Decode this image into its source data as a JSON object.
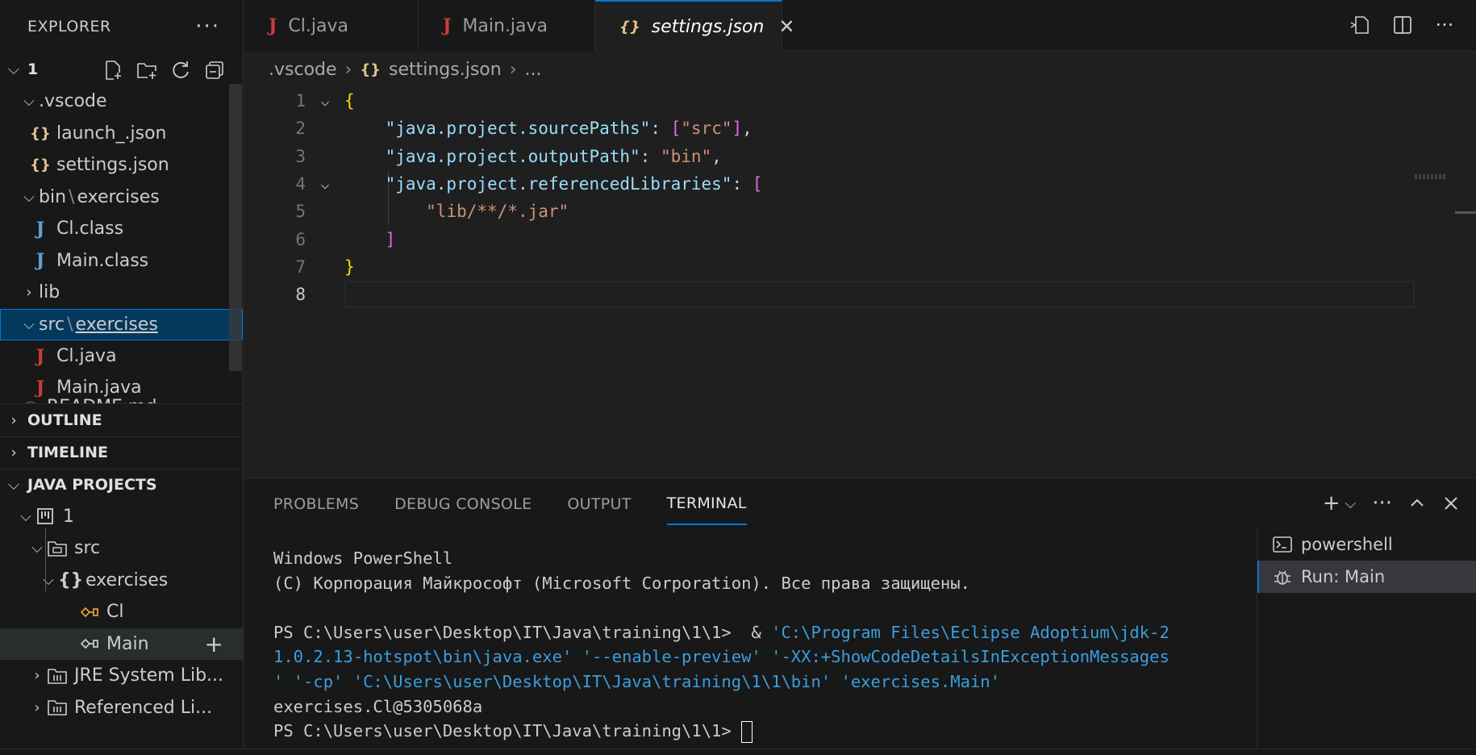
{
  "explorer": {
    "title": "EXPLORER",
    "more": "···",
    "root_label": "1",
    "tree": {
      "vscode_folder": ".vscode",
      "launch_file": "launch_.json",
      "settings_file": "settings.json",
      "bin_folder_a": "bin",
      "bin_folder_b": "exercises",
      "cl_class": "Cl.class",
      "main_class": "Main.class",
      "lib_folder": "lib",
      "src_folder_a": "src",
      "src_folder_b": "exercises",
      "cl_java": "Cl.java",
      "main_java": "Main.java",
      "readme_partial": "README.md"
    },
    "sections": {
      "outline": "OUTLINE",
      "timeline": "TIMELINE",
      "java_projects": "JAVA PROJECTS"
    },
    "java_projects": {
      "project": "1",
      "src": "src",
      "package": "exercises",
      "class_cl": "Cl",
      "class_main": "Main",
      "jre": "JRE System Lib...",
      "referenced": "Referenced Li..."
    }
  },
  "tabs": [
    {
      "label": "Cl.java"
    },
    {
      "label": "Main.java"
    },
    {
      "label": "settings.json",
      "close": "✕"
    }
  ],
  "breadcrumb": {
    "folder": ".vscode",
    "file": "settings.json",
    "more": "..."
  },
  "code": {
    "line_numbers": [
      "1",
      "2",
      "3",
      "4",
      "5",
      "6",
      "7",
      "8"
    ],
    "l1_brace": "{",
    "l2_key": "\"java.project.sourcePaths\"",
    "l2_colon": ": ",
    "l2_open": "[",
    "l2_val": "\"src\"",
    "l2_close": "]",
    "l2_comma": ",",
    "l3_key": "\"java.project.outputPath\"",
    "l3_colon": ": ",
    "l3_val": "\"bin\"",
    "l3_comma": ",",
    "l4_key": "\"java.project.referencedLibraries\"",
    "l4_colon": ": ",
    "l4_open": "[",
    "l5_val": "\"lib/**/*.jar\"",
    "l6_close": "]",
    "l7_brace": "}"
  },
  "panel": {
    "tabs": [
      "PROBLEMS",
      "DEBUG CONSOLE",
      "OUTPUT",
      "TERMINAL"
    ],
    "terminal": {
      "line1": "Windows PowerShell",
      "line2": "(C) Корпорация Майкрософт (Microsoft Corporation). Все права защищены.",
      "prompt1": "PS C:\\Users\\user\\Desktop\\IT\\Java\\training\\1\\1>  & ",
      "cmd1": "'C:\\Program Files\\Eclipse Adoptium\\jdk-2",
      "cmd2": "1.0.2.13-hotspot\\bin\\java.exe' '--enable-preview' '-XX:+ShowCodeDetailsInExceptionMessages",
      "cmd3": "' '-cp' 'C:\\Users\\user\\Desktop\\IT\\Java\\training\\1\\1\\bin' 'exercises.Main'",
      "output": "exercises.Cl@5305068a",
      "prompt2": "PS C:\\Users\\user\\Desktop\\IT\\Java\\training\\1\\1> "
    },
    "terminals": [
      {
        "label": "powershell"
      },
      {
        "label": "Run: Main"
      }
    ]
  },
  "colors": {
    "accent": "#0078d4",
    "json_key": "#9cdcfe",
    "json_string": "#ce9178",
    "bracket_gold": "#ffd700",
    "bracket_pink": "#da70d6",
    "java_icon": "#cd3b3b",
    "class_icon": "#5fa4d4",
    "command_blue": "#3b9ede"
  }
}
